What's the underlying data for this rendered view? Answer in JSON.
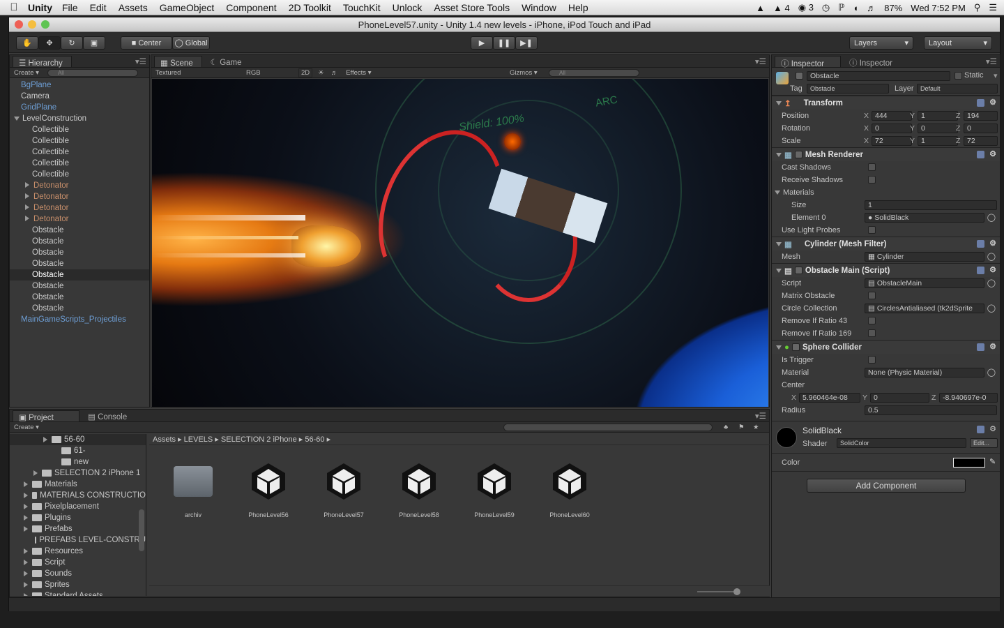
{
  "menubar": {
    "app": "Unity",
    "items": [
      "File",
      "Edit",
      "Assets",
      "GameObject",
      "Component",
      "2D Toolkit",
      "TouchKit",
      "Unlock",
      "Asset Store Tools",
      "Window",
      "Help"
    ],
    "status": {
      "adobe": "4",
      "cc": "3",
      "battery": "87%",
      "clock": "Wed 7:52 PM"
    }
  },
  "window": {
    "title": "PhoneLevel57.unity - Unity 1.4 new levels - iPhone, iPod Touch and iPad"
  },
  "toolbar": {
    "center": "Center",
    "global": "Global",
    "layers": "Layers",
    "layout": "Layout"
  },
  "hierarchy": {
    "tab": "Hierarchy",
    "create": "Create",
    "search": "All",
    "items": [
      {
        "label": "BgPlane",
        "style": "blue",
        "indent": 0
      },
      {
        "label": "Camera",
        "style": "normal",
        "indent": 0
      },
      {
        "label": "GridPlane",
        "style": "blue",
        "indent": 0
      },
      {
        "label": "LevelConstruction",
        "style": "normal",
        "indent": 0
      },
      {
        "label": "Collectible",
        "style": "normal",
        "indent": 2
      },
      {
        "label": "Collectible",
        "style": "normal",
        "indent": 2
      },
      {
        "label": "Collectible",
        "style": "normal",
        "indent": 2
      },
      {
        "label": "Collectible",
        "style": "normal",
        "indent": 2
      },
      {
        "label": "Collectible",
        "style": "normal",
        "indent": 2
      },
      {
        "label": "Detonator",
        "style": "orange",
        "indent": 2
      },
      {
        "label": "Detonator",
        "style": "orange",
        "indent": 2
      },
      {
        "label": "Detonator",
        "style": "orange",
        "indent": 2
      },
      {
        "label": "Detonator",
        "style": "orange",
        "indent": 2
      },
      {
        "label": "Obstacle",
        "style": "normal",
        "indent": 2
      },
      {
        "label": "Obstacle",
        "style": "normal",
        "indent": 2
      },
      {
        "label": "Obstacle",
        "style": "normal",
        "indent": 2
      },
      {
        "label": "Obstacle",
        "style": "normal",
        "indent": 2
      },
      {
        "label": "Obstacle",
        "style": "sel",
        "indent": 2
      },
      {
        "label": "Obstacle",
        "style": "normal",
        "indent": 2
      },
      {
        "label": "Obstacle",
        "style": "normal",
        "indent": 2
      },
      {
        "label": "Obstacle",
        "style": "normal",
        "indent": 2
      },
      {
        "label": "MainGameScripts_Projectiles",
        "style": "blue",
        "indent": 0
      }
    ]
  },
  "scene": {
    "tab_scene": "Scene",
    "tab_game": "Game",
    "textured": "Textured",
    "rgb": "RGB",
    "mode2d": "2D",
    "effects": "Effects",
    "gizmos": "Gizmos",
    "search": "All",
    "hud_shield": "Shield: 100%",
    "hud_arc": "ARC"
  },
  "inspector": {
    "tab1": "Inspector",
    "tab2": "Inspector",
    "object_name": "Obstacle",
    "static": "Static",
    "tag_label": "Tag",
    "tag": "Obstacle",
    "layer_label": "Layer",
    "layer": "Default",
    "transform": {
      "title": "Transform",
      "position": [
        "444",
        "1",
        "194"
      ],
      "rotation": [
        "0",
        "0",
        "0"
      ],
      "scale": [
        "72",
        "1",
        "72"
      ],
      "labels": {
        "position": "Position",
        "rotation": "Rotation",
        "scale": "Scale"
      }
    },
    "mesh_renderer": {
      "title": "Mesh Renderer",
      "cast": "Cast Shadows",
      "receive": "Receive Shadows",
      "materials": "Materials",
      "size_label": "Size",
      "size": "1",
      "element_label": "Element 0",
      "element": "SolidBlack",
      "probes": "Use Light Probes"
    },
    "mesh_filter": {
      "title": "Cylinder (Mesh Filter)",
      "mesh_label": "Mesh",
      "mesh": "Cylinder"
    },
    "script": {
      "title": "Obstacle Main (Script)",
      "script_label": "Script",
      "script": "ObstacleMain",
      "matrix": "Matrix Obstacle",
      "circle_label": "Circle Collection",
      "circle": "CirclesAntialiased (tk2dSprite",
      "r43": "Remove If Ratio 43",
      "r169": "Remove If Ratio 169"
    },
    "collider": {
      "title": "Sphere Collider",
      "trigger": "Is Trigger",
      "material_label": "Material",
      "material": "None (Physic Material)",
      "center_label": "Center",
      "cx": "5.960464e-08",
      "cy": "0",
      "cz": "-8.940697e-0",
      "radius_label": "Radius",
      "radius": "0.5"
    },
    "material": {
      "name": "SolidBlack",
      "shader_label": "Shader",
      "shader": "SolidColor",
      "edit": "Edit...",
      "color_label": "Color"
    },
    "add_component": "Add Component"
  },
  "project": {
    "tab_project": "Project",
    "tab_console": "Console",
    "create": "Create",
    "tree": [
      {
        "label": "56-60",
        "indent": 3,
        "arrow": "right",
        "sel": true
      },
      {
        "label": "61-",
        "indent": 4,
        "arrow": "none"
      },
      {
        "label": "new",
        "indent": 4,
        "arrow": "none"
      },
      {
        "label": "SELECTION 2 iPhone 1",
        "indent": 2,
        "arrow": "right"
      },
      {
        "label": "Materials",
        "indent": 1,
        "arrow": "right"
      },
      {
        "label": "MATERIALS CONSTRUCTIO",
        "indent": 1,
        "arrow": "right"
      },
      {
        "label": "Pixelplacement",
        "indent": 1,
        "arrow": "right"
      },
      {
        "label": "Plugins",
        "indent": 1,
        "arrow": "right"
      },
      {
        "label": "Prefabs",
        "indent": 1,
        "arrow": "right"
      },
      {
        "label": "PREFABS LEVEL-CONSTRU",
        "indent": 2,
        "arrow": "none"
      },
      {
        "label": "Resources",
        "indent": 1,
        "arrow": "right"
      },
      {
        "label": "Script",
        "indent": 1,
        "arrow": "right"
      },
      {
        "label": "Sounds",
        "indent": 1,
        "arrow": "right"
      },
      {
        "label": "Sprites",
        "indent": 1,
        "arrow": "right"
      },
      {
        "label": "Standard Assets",
        "indent": 1,
        "arrow": "right"
      }
    ],
    "breadcrumb": [
      "Assets",
      "LEVELS",
      "SELECTION 2 iPhone",
      "56-60"
    ],
    "assets": [
      "archiv",
      "PhoneLevel56",
      "PhoneLevel57",
      "PhoneLevel58",
      "PhoneLevel59",
      "PhoneLevel60"
    ]
  }
}
